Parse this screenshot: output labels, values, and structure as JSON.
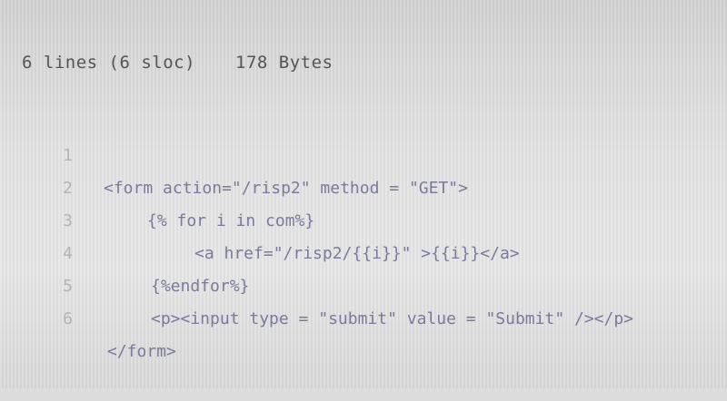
{
  "file_info": {
    "lines_label": "6 lines (6 sloc)",
    "size_label": "178 Bytes"
  },
  "code_lines": [
    {
      "number": "1",
      "text": "<form action=\"/risp2\" method = \"GET\">"
    },
    {
      "number": "2",
      "text": "{% for i in com%}"
    },
    {
      "number": "3",
      "text": "<a href=\"/risp2/{{i}}\" >{{i}}</a>"
    },
    {
      "number": "4",
      "text": "{%endfor%}"
    },
    {
      "number": "5",
      "text": "<p><input type = \"submit\" value = \"Submit\" /></p>"
    },
    {
      "number": "6",
      "text": "</form>"
    }
  ]
}
